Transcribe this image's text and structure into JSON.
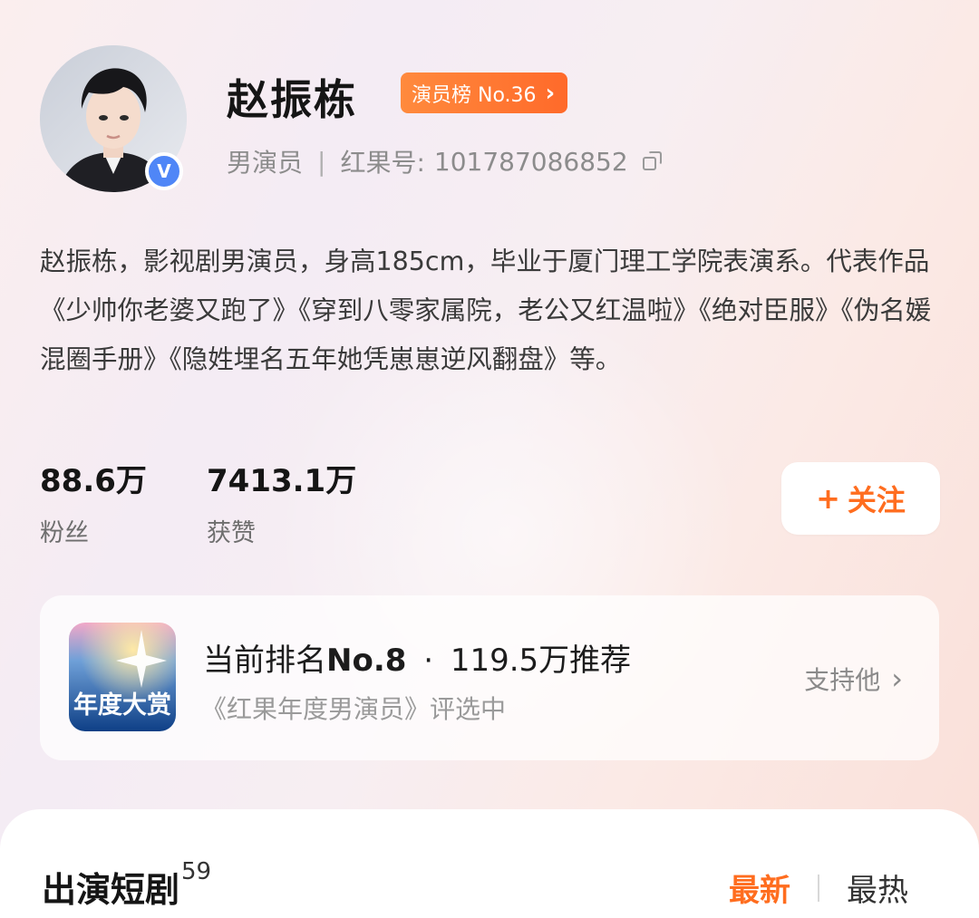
{
  "profile": {
    "name": "赵振栋",
    "rank_badge": "演员榜 No.36",
    "role": "男演员",
    "separator": "|",
    "id_label": "红果号:",
    "id_value": "101787086852",
    "verified_mark": "V"
  },
  "bio": "赵振栋，影视剧男演员，身高185cm，毕业于厦门理工学院表演系。代表作品《少帅你老婆又跑了》《穿到八零家属院，老公又红温啦》《绝对臣服》《伪名媛混圈手册》《隐姓埋名五年她凭崽崽逆风翻盘》等。",
  "stats": {
    "fans_value": "88.6万",
    "fans_label": "粉丝",
    "likes_value": "7413.1万",
    "likes_label": "获赞"
  },
  "follow_button": {
    "icon": "+",
    "label": "关注"
  },
  "award": {
    "logo_text": "年度大赏",
    "rank_prefix": "当前排名",
    "rank_value": "No.8",
    "dot": "·",
    "recommend": "119.5万推荐",
    "subtitle": "《红果年度男演员》评选中",
    "support_label": "支持他"
  },
  "dramas": {
    "title": "出演短剧",
    "count": "59",
    "tab_latest": "最新",
    "tab_hot": "最热"
  },
  "colors": {
    "accent": "#ff6d1f",
    "badge": "#ff7a34",
    "verify": "#4f86f7"
  },
  "icons": {
    "rank_chevron": "chevron-right-icon",
    "copy": "copy-icon",
    "support_chevron": "chevron-right-icon",
    "verify": "verified-icon"
  }
}
